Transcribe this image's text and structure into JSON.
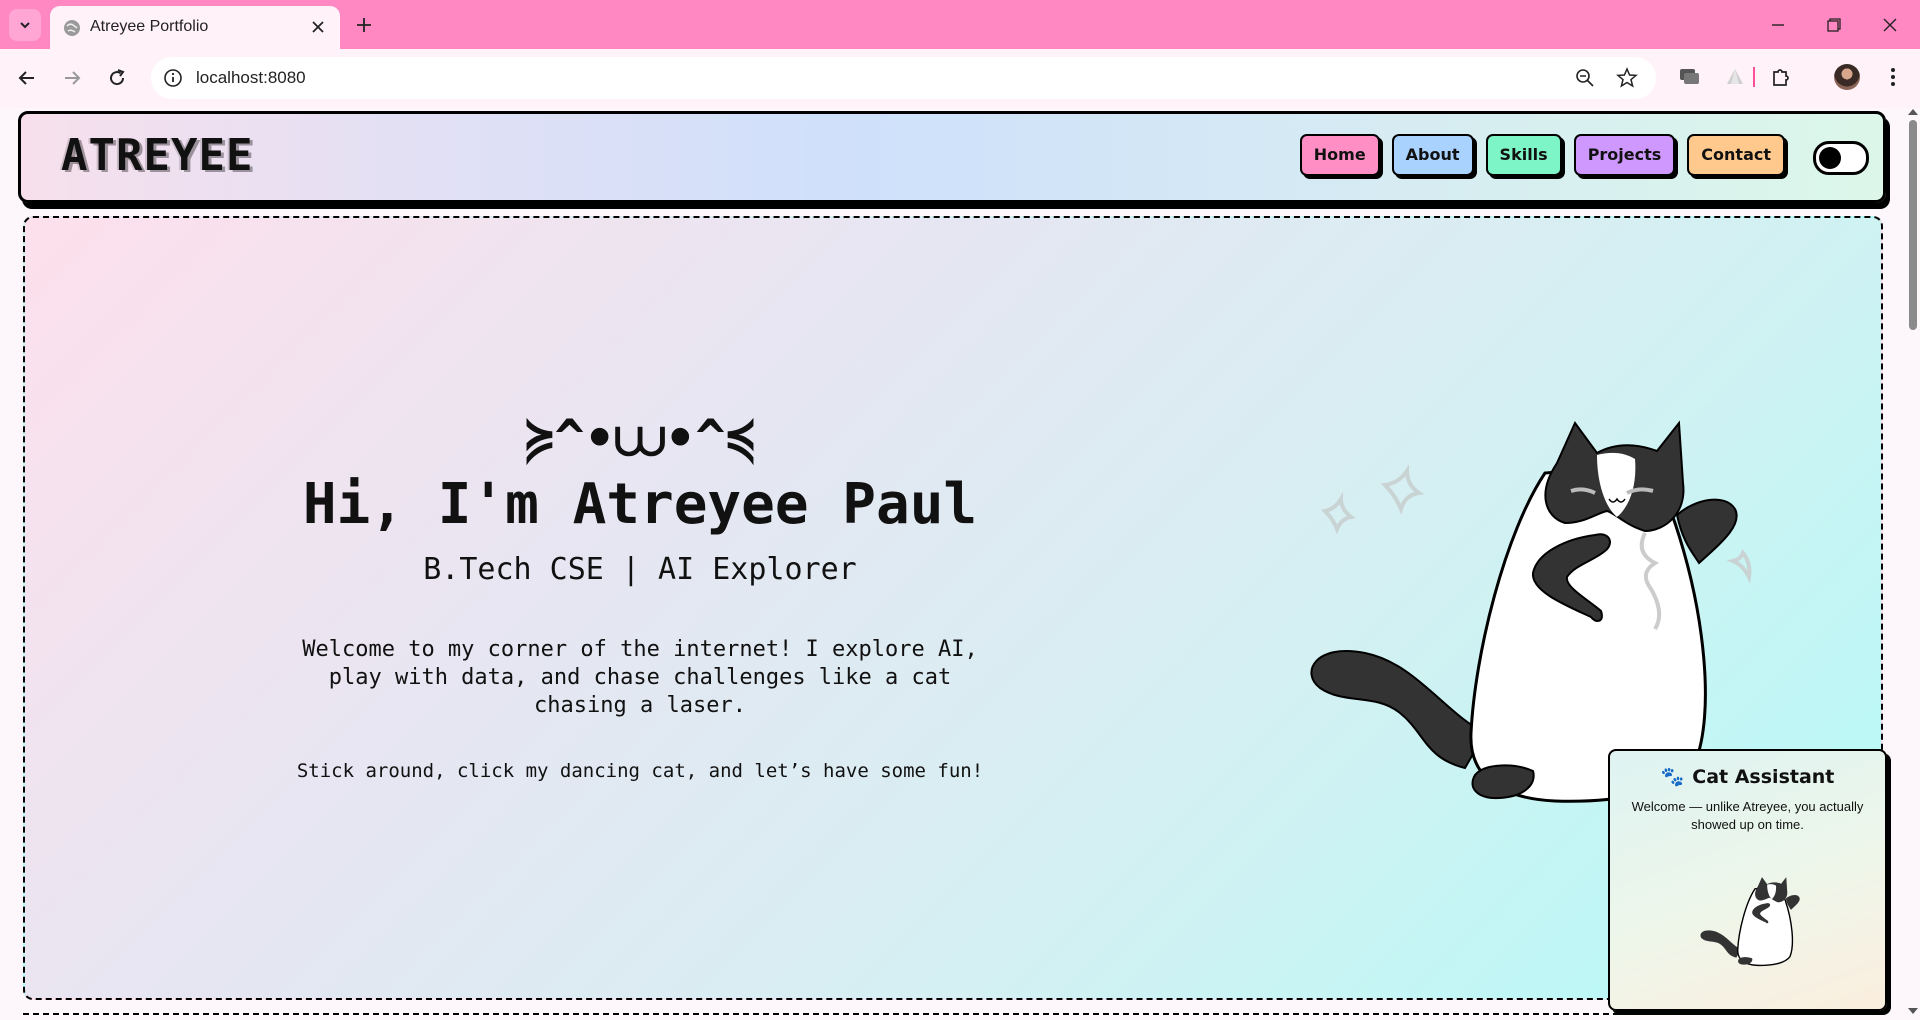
{
  "browser": {
    "tab_title": "Atreyee Portfolio",
    "url": "localhost:8080",
    "icons": [
      "tab-search-icon",
      "globe-icon",
      "close-icon",
      "plus-icon",
      "minimize-icon",
      "restore-icon",
      "window-close-icon",
      "back-icon",
      "forward-icon",
      "reload-icon",
      "site-info-icon",
      "zoom-out-icon",
      "star-icon",
      "extension-icon",
      "puzzle-icon",
      "profile-avatar",
      "more-icon"
    ],
    "theme_color": "#ff87c2"
  },
  "navbar": {
    "logo": "ATREYEE",
    "links": [
      {
        "label": "Home",
        "color": "#ff8ec4"
      },
      {
        "label": "About",
        "color": "#a9d2ff"
      },
      {
        "label": "Skills",
        "color": "#7ef5c6"
      },
      {
        "label": "Projects",
        "color": "#cf98ff"
      },
      {
        "label": "Contact",
        "color": "#ffc98e"
      }
    ],
    "theme_toggle_on": false
  },
  "hero": {
    "kaomoji": "≽^•⩊•^≼",
    "title": "Hi, I'm Atreyee Paul",
    "subtitle": "B.Tech CSE | AI Explorer",
    "intro": "Welcome to my corner of the internet! I explore AI, play with data, and chase challenges like a cat chasing a laser.",
    "cta": "Stick around, click my dancing cat, and let’s have some fun!"
  },
  "assistant": {
    "icon": "🐾",
    "title": "Cat Assistant",
    "message": "Welcome — unlike Atreyee, you actually showed up on time."
  }
}
